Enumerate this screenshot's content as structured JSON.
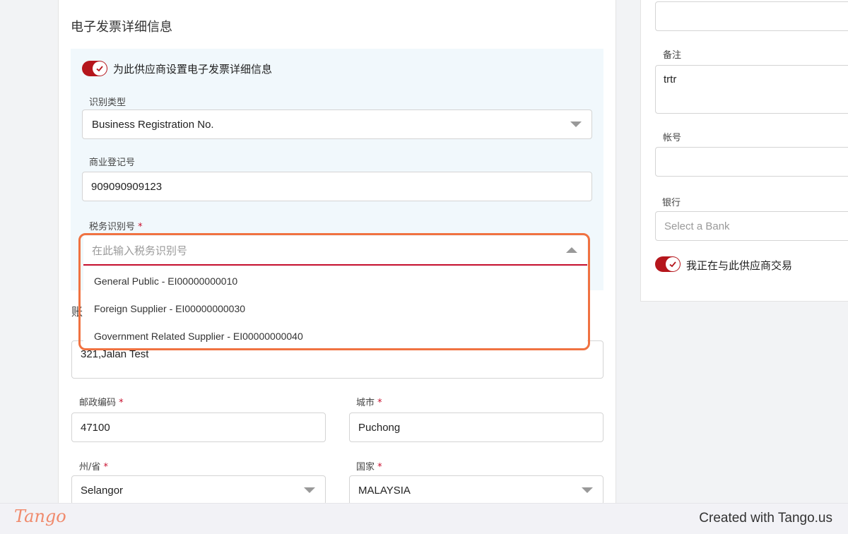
{
  "section": {
    "title": "电子发票详细信息",
    "einvoice_toggle_label": "为此供应商设置电子发票详细信息"
  },
  "fields": {
    "id_type": {
      "label": "识别类型",
      "value": "Business Registration No."
    },
    "brn": {
      "label": "商业登记号",
      "value": "909090909123"
    },
    "tin": {
      "label": "税务识别号",
      "required_mark": "*",
      "placeholder": "在此输入税务识别号"
    },
    "address_label_partial": "账",
    "address_value": "321,Jalan Test",
    "postcode": {
      "label": "邮政编码",
      "required_mark": "*",
      "value": "47100"
    },
    "city": {
      "label": "城市",
      "required_mark": "*",
      "value": "Puchong"
    },
    "state": {
      "label": "州/省",
      "required_mark": "*",
      "value": "Selangor"
    },
    "country": {
      "label": "国家",
      "required_mark": "*",
      "value": "MALAYSIA"
    }
  },
  "tin_dropdown": {
    "options": [
      "General Public - EI00000000010",
      "Foreign Supplier - EI00000000030",
      "Government Related Supplier - EI00000000040"
    ]
  },
  "right_panel": {
    "remarks": {
      "label": "备注",
      "value": "trtr"
    },
    "account": {
      "label": "帐号",
      "value": ""
    },
    "bank": {
      "label": "银行",
      "placeholder": "Select a Bank"
    },
    "trading_toggle_label": "我正在与此供应商交易"
  },
  "footer": {
    "logo": "Tango",
    "credit": "Created with Tango.us"
  },
  "colors": {
    "toggle_on": "#b5161c",
    "highlight": "#f07241",
    "required": "#c8102e",
    "panel_bg": "#f1f8fc"
  }
}
